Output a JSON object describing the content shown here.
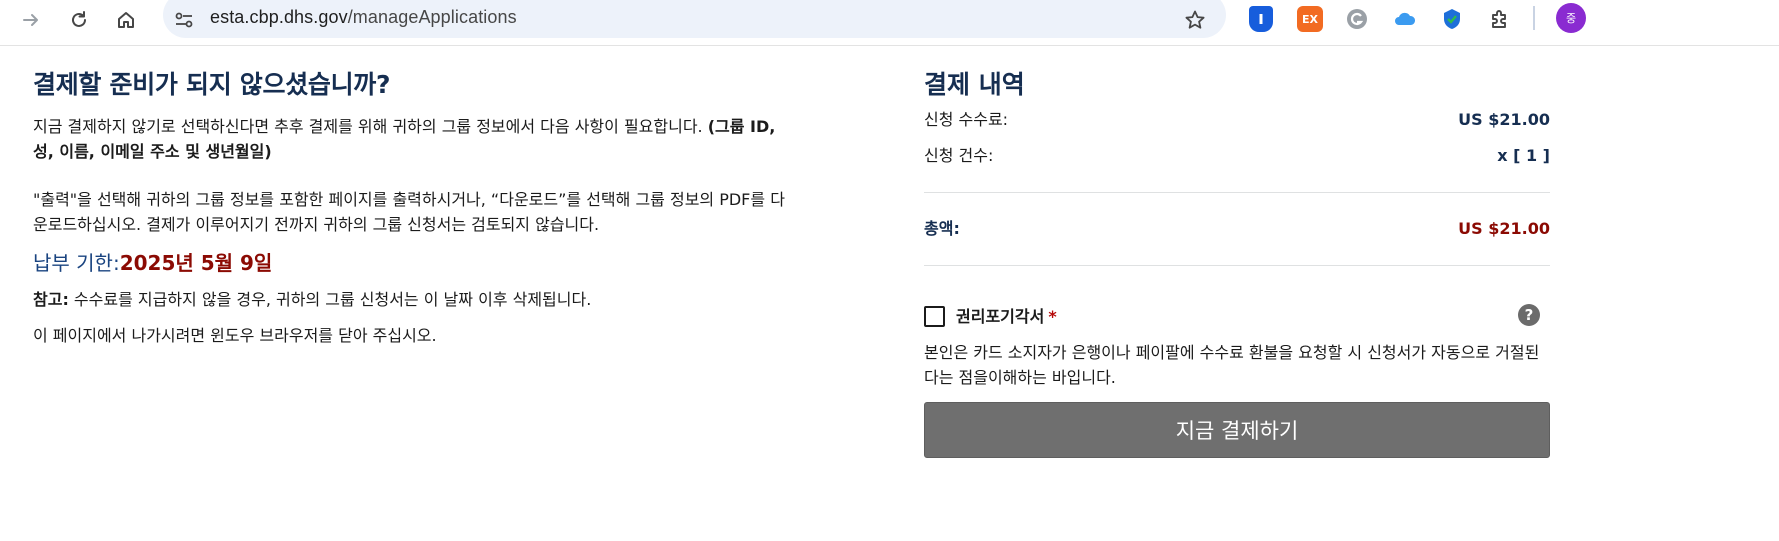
{
  "browser": {
    "url_host": "esta.cbp.dhs.gov",
    "url_path": "/manageApplications",
    "icons": [
      "forward-icon",
      "reload-icon",
      "home-icon",
      "site-info-icon",
      "bookmark-star-icon",
      "bitwarden-icon",
      "ex-extension-icon",
      "grammarly-icon",
      "icloud-icon",
      "extension-icon",
      "extensions-puzzle-icon",
      "profile-avatar"
    ],
    "ext_ex_label": "EX",
    "profile_initial": "중"
  },
  "left": {
    "title": "결제할 준비가 되지 않으셨습니까?",
    "p1_text": "지금 결제하지 않기로 선택하신다면 추후 결제를 위해 귀하의 그룹 정보에서 다음 사항이 필요합니다. ",
    "p1_bold": "(그룹 ID, 성, 이름, 이메일 주소 및 생년월일)",
    "p2": "\"출력\"을 선택해 귀하의 그룹 정보를 포함한 페이지를 출력하시거나, “다운로드”를 선택해 그룹 정보의 PDF를 다운로드하십시오. 결제가 이루어지기 전까지 귀하의 그룹 신청서는 검토되지 않습니다.",
    "due_label": "납부 기한:",
    "due_value": "2025년 5월 9일",
    "note_label": "참고:",
    "note_text": " 수수료를 지급하지 않을 경우, 귀하의 그룹 신청서는 이 날짜 이후 삭제됩니다.",
    "close_msg": "이 페이지에서 나가시려면 윈도우 브라우저를 닫아 주십시오."
  },
  "summary": {
    "title": "결제 내역",
    "fee_label": "신청 수수료:",
    "fee_value": "US $21.00",
    "count_label": "신청 건수:",
    "count_value": "x [ 1 ]",
    "total_label": "총액:",
    "total_value": "US $21.00",
    "waiver_label": "권리포기각서",
    "waiver_required": "*",
    "waiver_checked": false,
    "help_glyph": "?",
    "waiver_text": "본인은 카드 소지자가 은행이나 페이팔에 수수료 환불을 요청할 시 신청서가 자동으로 거절된다는 점을이해하는 바입니다.",
    "pay_button": "지금 결제하기"
  },
  "colors": {
    "heading": "#162e51",
    "due_label": "#1a4480",
    "alert_red": "#8b0a03",
    "button_gray": "#6f6f6f",
    "omnibox": "#edf2fa"
  }
}
